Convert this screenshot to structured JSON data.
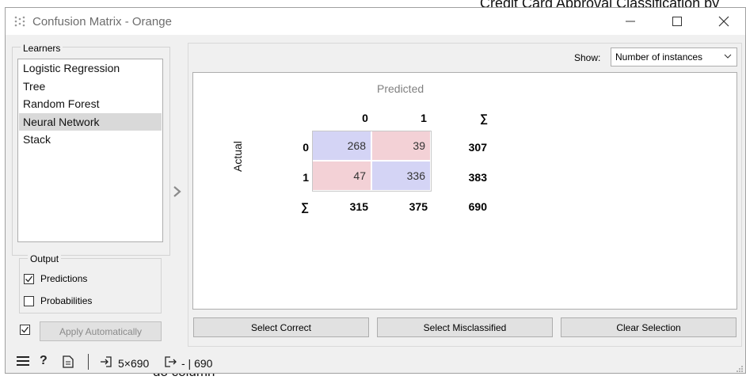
{
  "background": {
    "top_text": "Credit Card Approval Classification by",
    "bottom_text": "do column"
  },
  "window": {
    "title": "Confusion Matrix - Orange"
  },
  "learners": {
    "title": "Learners",
    "items": [
      {
        "label": "Logistic Regression",
        "selected": false
      },
      {
        "label": "Tree",
        "selected": false
      },
      {
        "label": "Random Forest",
        "selected": false
      },
      {
        "label": "Neural Network",
        "selected": true
      },
      {
        "label": "Stack",
        "selected": false
      }
    ]
  },
  "output": {
    "title": "Output",
    "predictions": {
      "label": "Predictions",
      "checked": true
    },
    "probabilities": {
      "label": "Probabilities",
      "checked": false
    }
  },
  "apply": {
    "label": "Apply Automatically",
    "checked": true
  },
  "show": {
    "label": "Show:",
    "value": "Number of instances"
  },
  "matrix": {
    "predicted_label": "Predicted",
    "actual_label": "Actual",
    "columns": [
      "0",
      "1",
      "∑"
    ],
    "rows": [
      {
        "label": "0",
        "values": [
          "268",
          "39"
        ],
        "total": "307"
      },
      {
        "label": "1",
        "values": [
          "47",
          "336"
        ],
        "total": "383"
      }
    ],
    "total_label": "∑",
    "col_totals": [
      "315",
      "375"
    ],
    "grand_total": "690"
  },
  "buttons": {
    "select_correct": "Select Correct",
    "select_misclassified": "Select Misclassified",
    "clear_selection": "Clear Selection"
  },
  "status": {
    "input": "5×690",
    "output": "- | 690"
  },
  "colors": {
    "correct": "#d4d4f5",
    "misclassified": "#f3d1d6",
    "selected_learner": "#d9d9d9"
  }
}
